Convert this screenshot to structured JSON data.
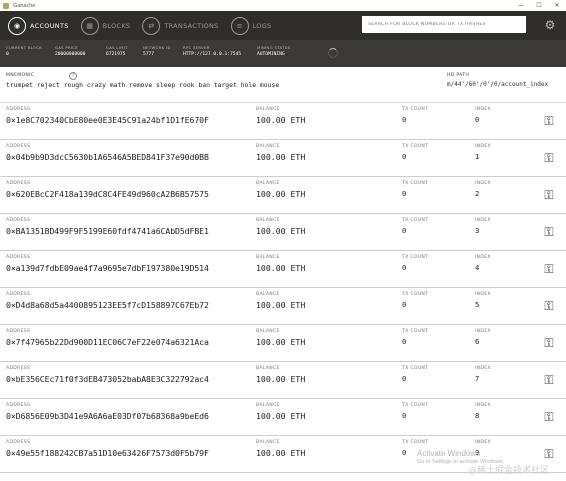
{
  "window": {
    "title": "Ganache",
    "minimize": "—",
    "maximize": "☐",
    "close": "✕"
  },
  "nav": {
    "items": [
      {
        "label": "ACCOUNTS",
        "icon": "accounts-icon",
        "glyph": "◉",
        "active": true
      },
      {
        "label": "BLOCKS",
        "icon": "blocks-icon",
        "glyph": "▦",
        "active": false
      },
      {
        "label": "TRANSACTIONS",
        "icon": "transactions-icon",
        "glyph": "⇄",
        "active": false
      },
      {
        "label": "LOGS",
        "icon": "logs-icon",
        "glyph": "≡",
        "active": false
      }
    ],
    "search_placeholder": "SEARCH FOR BLOCK NUMBERS OR TX HASHES",
    "settings_glyph": "⚙"
  },
  "status": {
    "current_block": {
      "label": "CURRENT BLOCK",
      "value": "0"
    },
    "gas_price": {
      "label": "GAS PRICE",
      "value": "20000000000"
    },
    "gas_limit": {
      "label": "GAS LIMIT",
      "value": "6721975"
    },
    "network_id": {
      "label": "NETWORK ID",
      "value": "5777"
    },
    "rpc_server": {
      "label": "RPC SERVER",
      "value": "HTTP://127.0.0.1:7545"
    },
    "mining_status": {
      "label": "MINING STATUS",
      "value": "AUTOMINING"
    }
  },
  "mnemonic": {
    "label": "MNEMONIC",
    "help_glyph": "?",
    "text": "trumpet reject rough crazy math remove sleep rook ban target hole mouse",
    "hd_path_label": "HD PATH",
    "hd_path": "m/44'/60'/0'/0/account_index"
  },
  "labels": {
    "address": "ADDRESS",
    "balance": "BALANCE",
    "tx_count": "TX COUNT",
    "index": "INDEX"
  },
  "key_glyph": "⚿",
  "accounts": [
    {
      "address": "0×1e8C702340CbE80ee0E3E45C91a24bf1D1fE670F",
      "balance": "100.00 ETH",
      "tx_count": "0",
      "index": "0"
    },
    {
      "address": "0×04b9b9D3dcC5630b1A6546A5BED841F37e90d0BB",
      "balance": "100.00 ETH",
      "tx_count": "0",
      "index": "1"
    },
    {
      "address": "0×620EBcC2F418a139dC8C4FE49d960cA2B6B57575",
      "balance": "100.00 ETH",
      "tx_count": "0",
      "index": "2"
    },
    {
      "address": "0×BA1351BD499F9F5199E60fdf4741a6CAbD5dFBE1",
      "balance": "100.00 ETH",
      "tx_count": "0",
      "index": "3"
    },
    {
      "address": "0×a139d7fdbE09ae4f7a9695e7dbF197380e19D514",
      "balance": "100.00 ETH",
      "tx_count": "0",
      "index": "4"
    },
    {
      "address": "0×D4d8a68d5a4400895123EE5f7cD158897C67Eb72",
      "balance": "100.00 ETH",
      "tx_count": "0",
      "index": "5"
    },
    {
      "address": "0×7f47965b22Dd900D11EC06C7eF22e074a6321Aca",
      "balance": "100.00 ETH",
      "tx_count": "0",
      "index": "6"
    },
    {
      "address": "0×bE356CEc71f0f3dEB473052babA8E3C322792ac4",
      "balance": "100.00 ETH",
      "tx_count": "0",
      "index": "7"
    },
    {
      "address": "0×D6856E09b3D41e9A6A6aE03Df07b68368a9beEd6",
      "balance": "100.00 ETH",
      "tx_count": "0",
      "index": "8"
    },
    {
      "address": "0×49e55f188242CB7a51D10e63426F7573d0F5b79F",
      "balance": "100.00 ETH",
      "tx_count": "0",
      "index": "9"
    }
  ],
  "watermark": {
    "line1": "Activate Windows",
    "line2": "Go to Settings to activate Windows.",
    "line3": "@稀土掘金技术社区"
  }
}
